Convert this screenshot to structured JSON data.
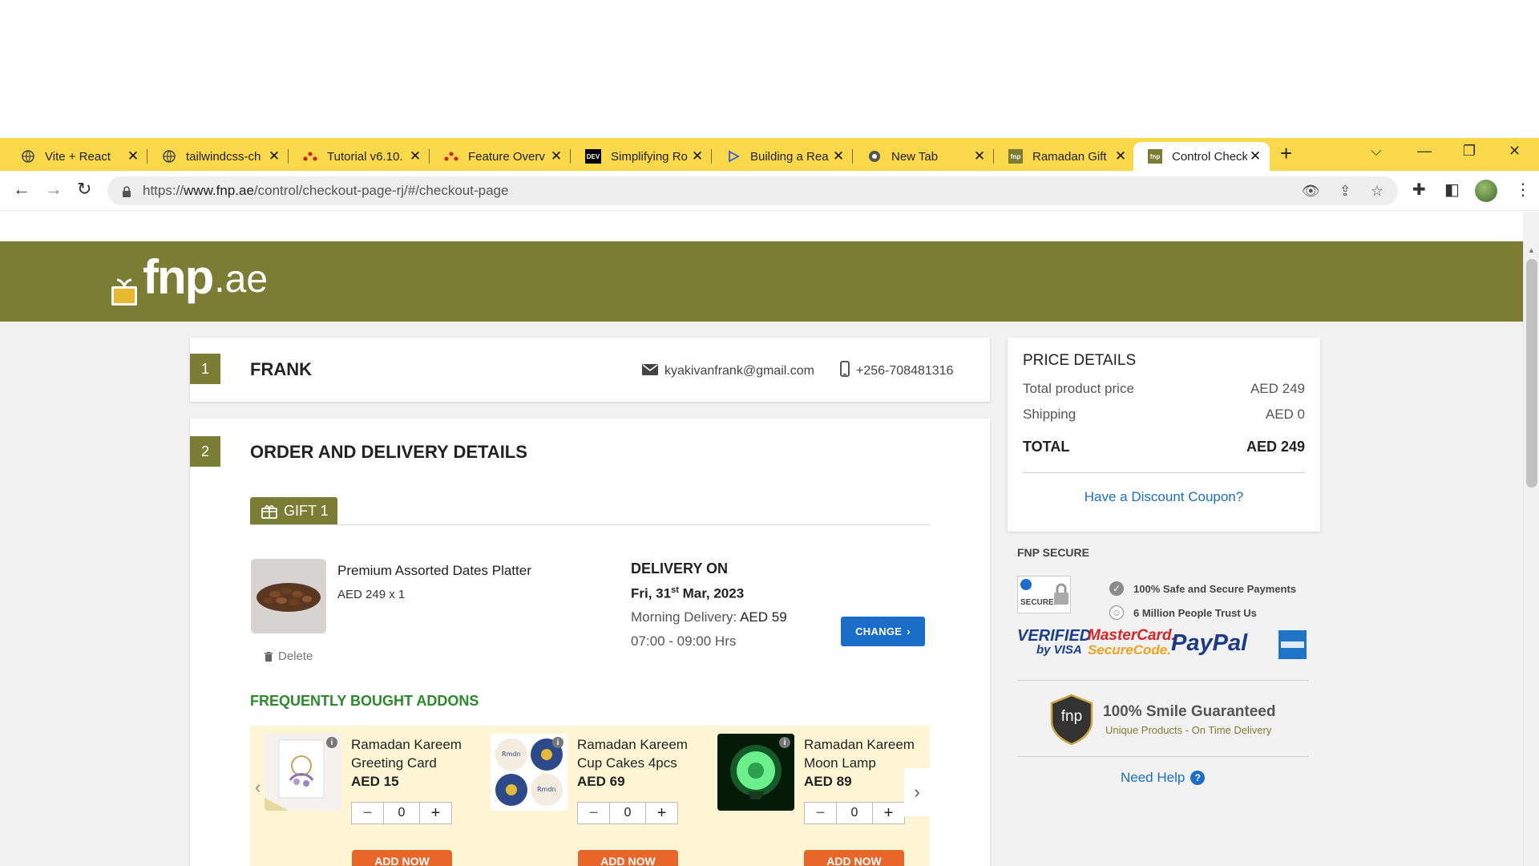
{
  "browser": {
    "tabs": [
      {
        "title": "Vite + React",
        "icon": "globe-icon"
      },
      {
        "title": "tailwindcss-ch",
        "icon": "globe-icon"
      },
      {
        "title": "Tutorial v6.10.",
        "icon": "react-router-icon"
      },
      {
        "title": "Feature Overv",
        "icon": "react-router-icon"
      },
      {
        "title": "Simplifying Ro",
        "icon": "dev-icon"
      },
      {
        "title": "Building a Rea",
        "icon": "play-icon"
      },
      {
        "title": "New Tab",
        "icon": "chrome-icon"
      },
      {
        "title": "Ramadan Gift",
        "icon": "fnp-icon"
      },
      {
        "title": "Control Check",
        "icon": "fnp-icon"
      }
    ],
    "url_prefix": "https://",
    "url_host": "www.fnp.ae",
    "url_path": "/control/checkout-page-rj/#/checkout-page"
  },
  "site": {
    "logo_word": "fnp",
    "logo_tld": ".ae",
    "brand_color": "#7b7d34"
  },
  "customer": {
    "step": "1",
    "name": "FRANK",
    "email": "kyakivanfrank@gmail.com",
    "phone": "+256-708481316"
  },
  "order": {
    "step": "2",
    "title": "ORDER AND DELIVERY DETAILS",
    "gift_label": "GIFT 1",
    "product_name": "Premium Assorted Dates Platter",
    "product_price": "AED 249 x 1",
    "delete_label": "Delete",
    "delivery_heading": "DELIVERY ON",
    "delivery_day_prefix": "Fri, 31",
    "delivery_day_sup": "st",
    "delivery_day_suffix": " Mar, 2023",
    "delivery_type": "Morning Delivery:",
    "delivery_fee": "AED 59",
    "delivery_time": "07:00 - 09:00 Hrs",
    "change_label": "CHANGE"
  },
  "addons": {
    "heading": "FREQUENTLY BOUGHT ADDONS",
    "items": [
      {
        "name_line1": "Ramadan Kareem",
        "name_line2": "Greeting Card",
        "price": "AED 15",
        "qty": "0",
        "button": "ADD NOW"
      },
      {
        "name_line1": "Ramadan Kareem",
        "name_line2": "Cup Cakes 4pcs",
        "price": "AED 69",
        "qty": "0",
        "button": "ADD NOW"
      },
      {
        "name_line1": "Ramadan Kareem",
        "name_line2": "Moon Lamp",
        "price": "AED 89",
        "qty": "0",
        "button": "ADD NOW"
      }
    ]
  },
  "price": {
    "title": "PRICE DETAILS",
    "rows": [
      {
        "label": "Total product price",
        "value": "AED 249"
      },
      {
        "label": "Shipping",
        "value": "AED 0"
      }
    ],
    "total_label": "TOTAL",
    "total_value": "AED 249",
    "coupon_link": "Have a Discount Coupon?"
  },
  "secure": {
    "heading": "FNP SECURE",
    "geotrust_label": "SECURED",
    "points": [
      "100% Safe and Secure Payments",
      "6 Million People Trust Us"
    ],
    "payments": [
      "VERIFIED",
      "by VISA",
      "MasterCard.",
      "SecureCode.",
      "PayPal"
    ],
    "smile_title": "100% Smile Guaranteed",
    "smile_sub": "Unique Products - On Time Delivery",
    "smile_badge": "fnp",
    "help_label": "Need Help"
  }
}
